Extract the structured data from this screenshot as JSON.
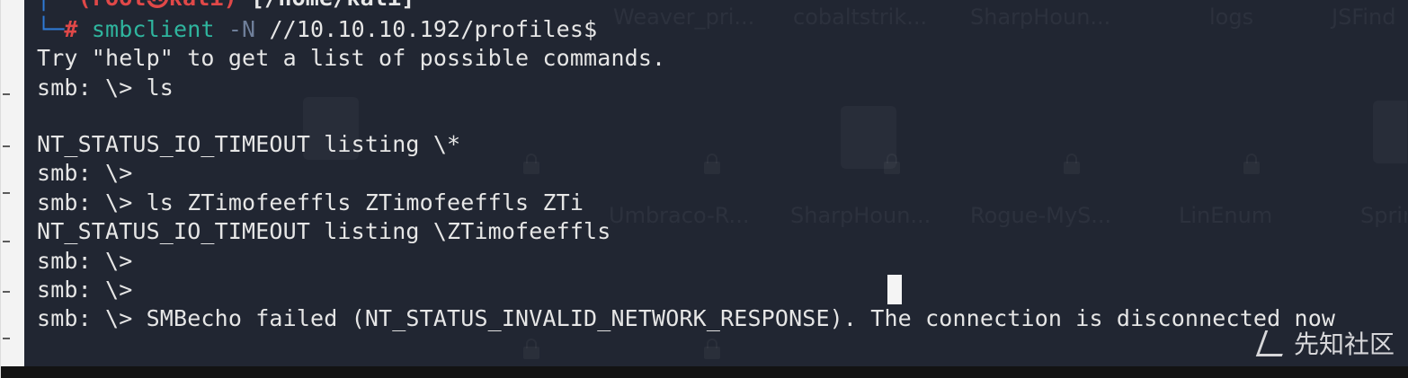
{
  "terminal": {
    "prompt_header": {
      "user": "(root㉿kali)",
      "path": "[/home/kali]"
    },
    "command": {
      "symbol": "└─#",
      "name": "smbclient",
      "option": "-N",
      "argument": "//10.10.10.192/profiles$"
    },
    "lines": [
      "Try \"help\" to get a list of possible commands.",
      "smb: \\> ls",
      "",
      "NT_STATUS_IO_TIMEOUT listing \\*",
      "smb: \\>",
      "smb: \\> ls ZTimofeeffls ZTimofeeffls ZTi",
      "NT_STATUS_IO_TIMEOUT listing \\ZTimofeeffls",
      "smb: \\>",
      "smb: \\>",
      "smb: \\> SMBecho failed (NT_STATUS_INVALID_NETWORK_RESPONSE). The connection is disconnected now"
    ]
  },
  "background_ghost": {
    "top_row": [
      "Weaver_pri...",
      "cobaltstrik...",
      "SharpHoun...",
      "logs",
      "JSFind"
    ],
    "middle_row": [
      "Umbraco-R...",
      "SharpHoun...",
      "Rogue-MyS...",
      "LinEnum",
      "Spring"
    ]
  },
  "watermark": {
    "text": "先知社区"
  },
  "colors": {
    "background": "#212632",
    "text": "#e6e6e6",
    "prompt_red": "#e04848",
    "prompt_blue": "#2f7bd6",
    "command_teal": "#2fb59e"
  }
}
